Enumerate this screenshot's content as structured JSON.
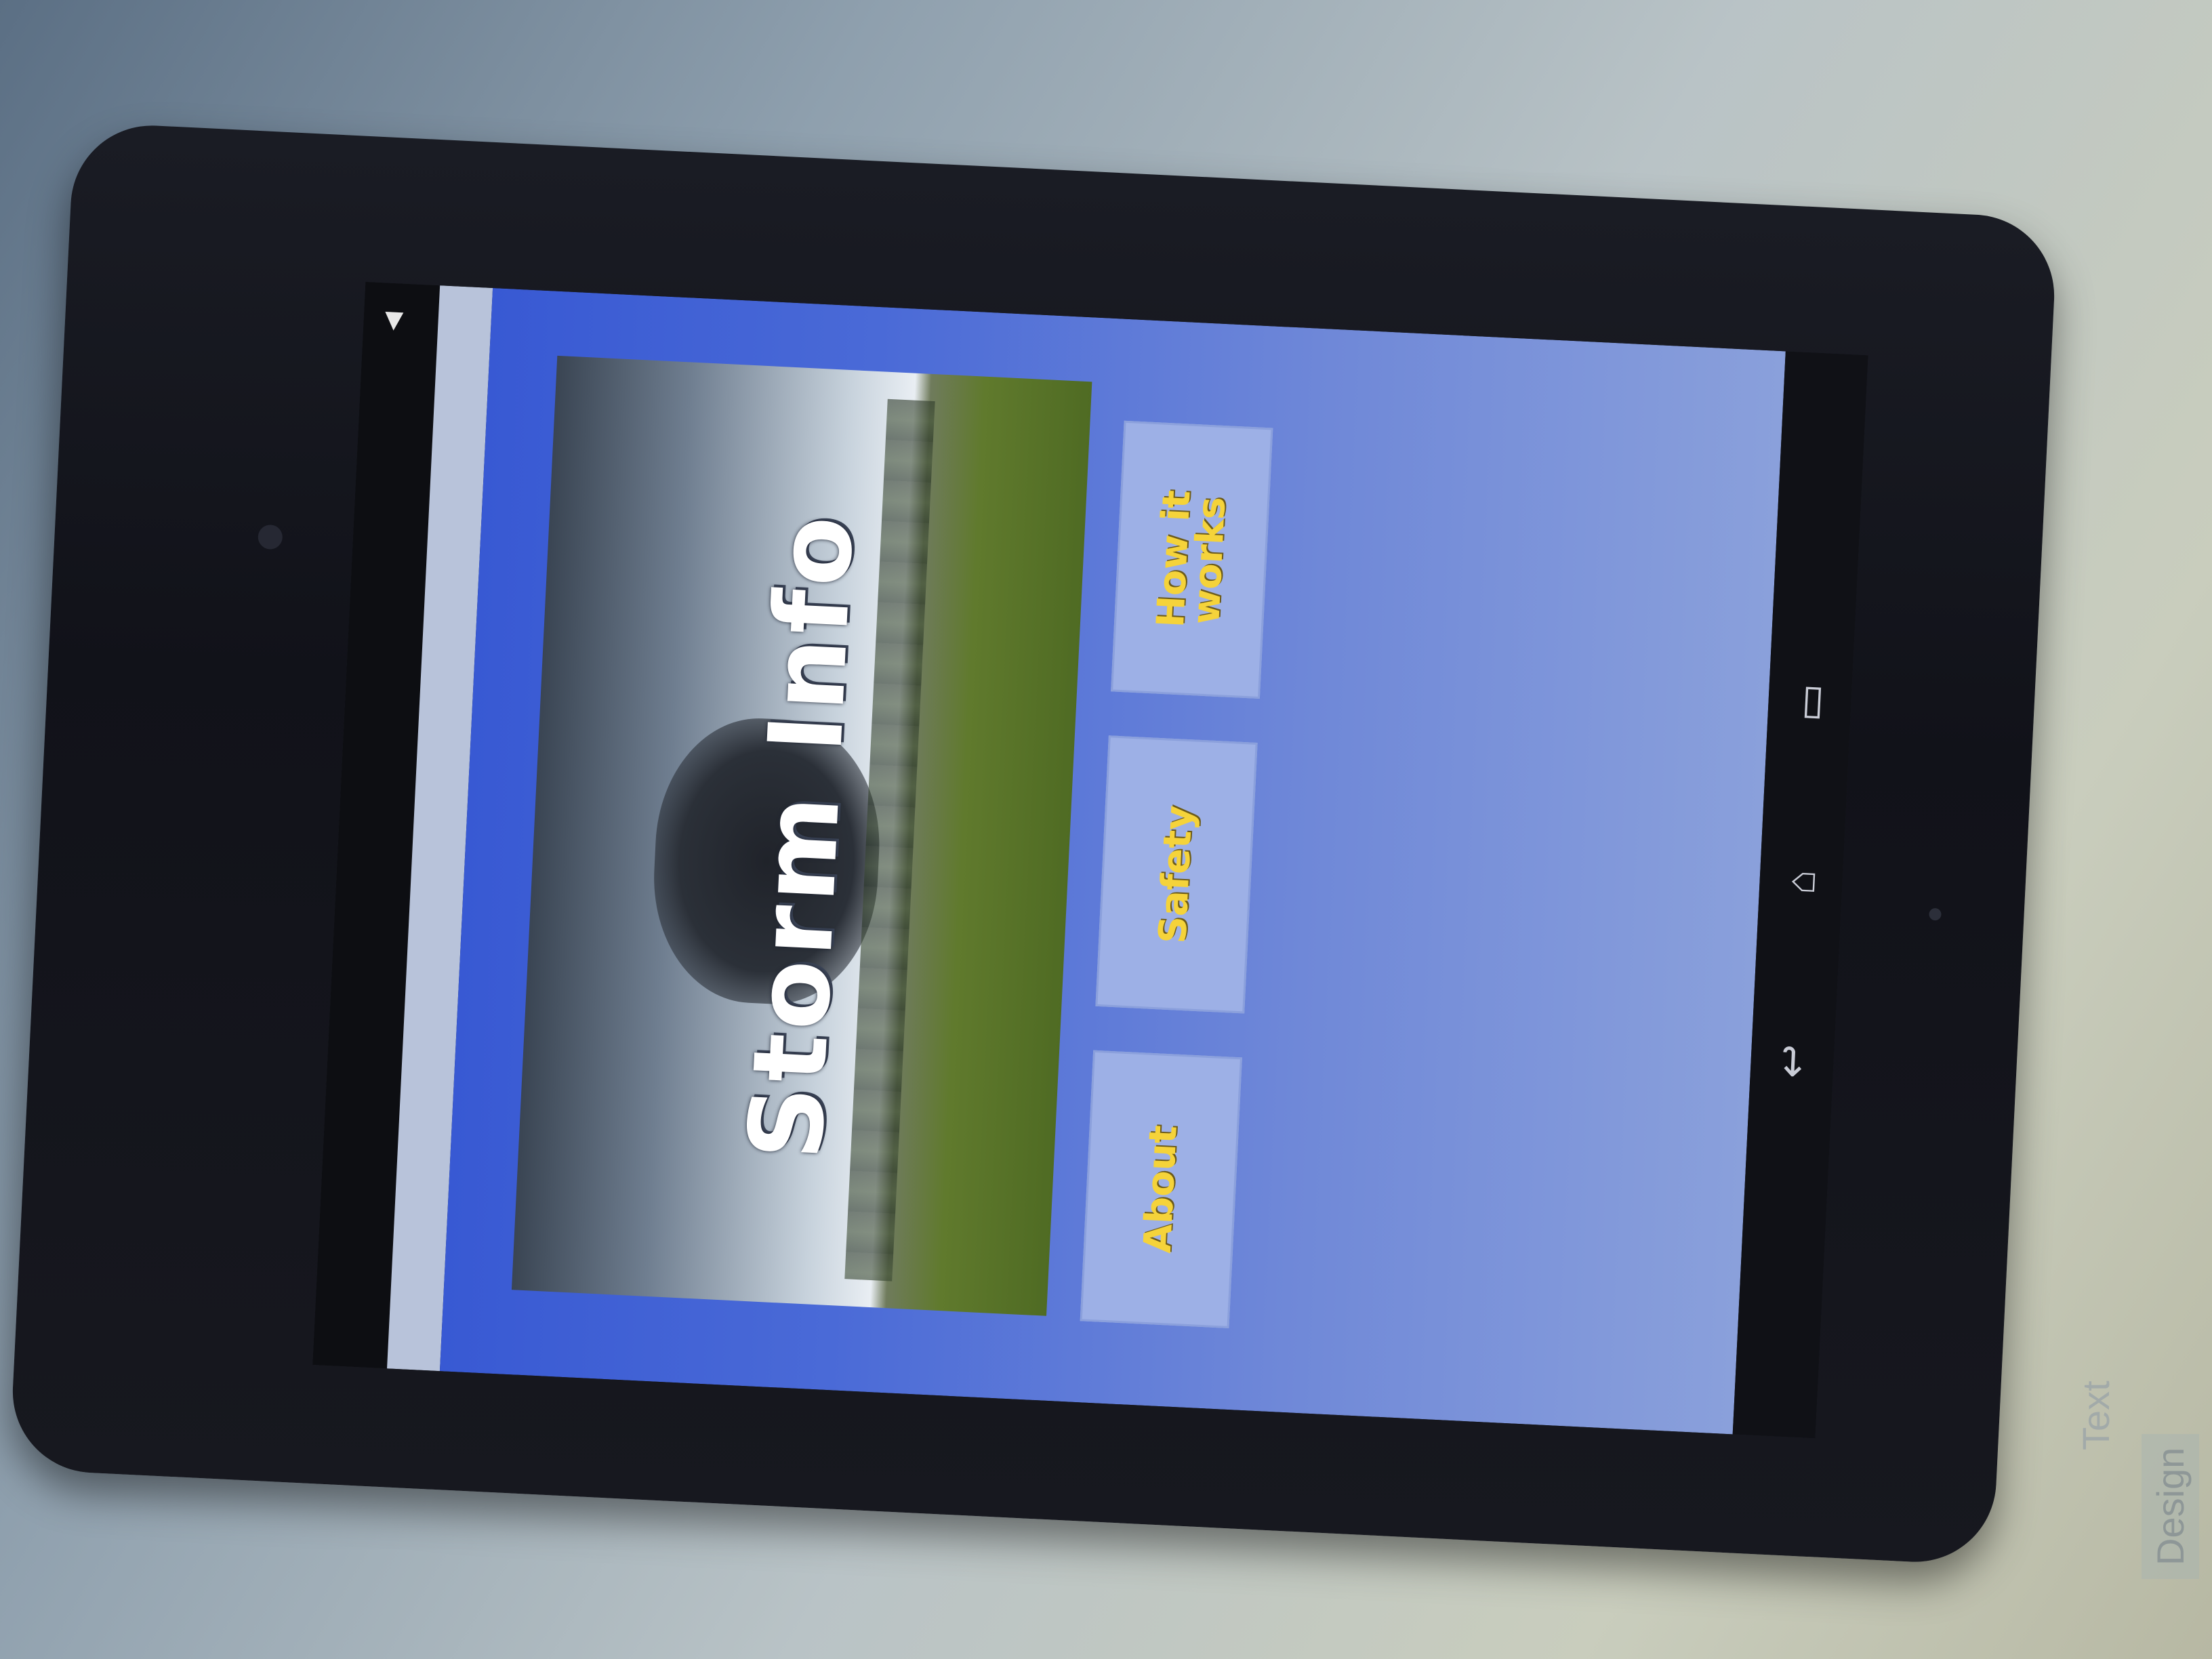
{
  "app": {
    "banner_title": "Storm Info",
    "buttons": {
      "about": "About",
      "safety": "Safety",
      "how_it_works": "How it works"
    },
    "colors": {
      "background": "#4a6ad7",
      "button": "#9db0e6",
      "button_text": "#f5d33a"
    }
  },
  "status_bar": {
    "icons": [
      "signal-icon"
    ]
  },
  "nav_bar": {
    "icons": [
      "back-icon",
      "home-icon",
      "recent-apps-icon"
    ]
  },
  "editor": {
    "tabs": [
      "Design",
      "Text"
    ]
  }
}
